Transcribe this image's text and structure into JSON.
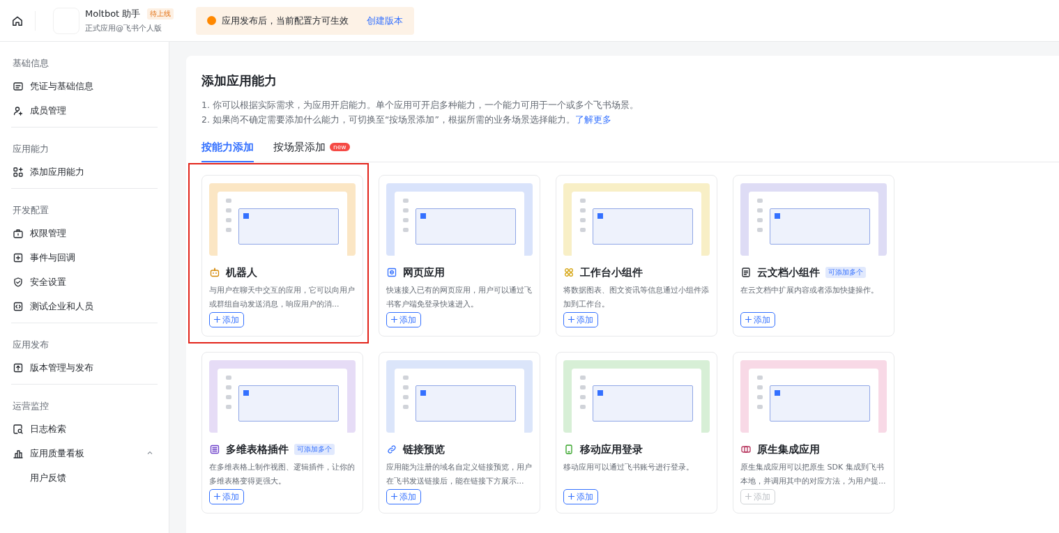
{
  "header": {
    "app_name": "Moltbot 助手",
    "status_badge": "待上线",
    "subtitle": "正式应用@飞书个人版"
  },
  "notice": {
    "text": "应用发布后，当前配置方可生效",
    "link": "创建版本"
  },
  "sidebar": {
    "sections": [
      {
        "label": "基础信息",
        "items": [
          {
            "label": "凭证与基础信息"
          },
          {
            "label": "成员管理"
          }
        ]
      },
      {
        "label": "应用能力",
        "items": [
          {
            "label": "添加应用能力"
          }
        ]
      },
      {
        "label": "开发配置",
        "items": [
          {
            "label": "权限管理"
          },
          {
            "label": "事件与回调"
          },
          {
            "label": "安全设置"
          },
          {
            "label": "测试企业和人员"
          }
        ]
      },
      {
        "label": "应用发布",
        "items": [
          {
            "label": "版本管理与发布"
          }
        ]
      },
      {
        "label": "运营监控",
        "items": [
          {
            "label": "日志检索"
          },
          {
            "label": "应用质量看板",
            "expanded": true,
            "children": [
              {
                "label": "用户反馈"
              }
            ]
          }
        ]
      }
    ]
  },
  "panel": {
    "title": "添加应用能力",
    "notes": [
      {
        "text": "1. 你可以根据实际需求，为应用开启能力。单个应用可开启多种能力，一个能力可用于一个或多个飞书场景。"
      },
      {
        "text": "2. 如果尚不确定需要添加什么能力，可切换至“按场景添加”，根据所需的业务场景选择能力。",
        "link": "了解更多"
      }
    ],
    "tabs": [
      {
        "label": "按能力添加",
        "selected": true
      },
      {
        "label": "按场景添加",
        "selected": false,
        "badge": "new"
      }
    ],
    "cards": [
      {
        "title": "机器人",
        "description": "与用户在聊天中交互的应用，它可以向用户或群组自动发送消息，响应用户的消...",
        "button": {
          "label": "添加",
          "disabled": false
        },
        "highlighted": true,
        "color": "#fbe6c4"
      },
      {
        "title": "网页应用",
        "description": "快速接入已有的网页应用，用户可以通过飞书客户端免登录快速进入。",
        "button": {
          "label": "添加",
          "disabled": false
        },
        "highlighted": false,
        "color": "#d9e3fb"
      },
      {
        "title": "工作台小组件",
        "description": "将数据图表、图文资讯等信息通过小组件添加到工作台。",
        "button": {
          "label": "添加",
          "disabled": false
        },
        "highlighted": false,
        "color": "#f8efc6"
      },
      {
        "title": "云文档小组件",
        "badge": "可添加多个",
        "description": "在云文档中扩展内容或者添加快捷操作。",
        "button": {
          "label": "添加",
          "disabled": false
        },
        "highlighted": false,
        "color": "#dedcf5"
      },
      {
        "title": "多维表格插件",
        "badge": "可添加多个",
        "description": "在多维表格上制作视图、逻辑插件，让你的多维表格变得更强大。",
        "button": {
          "label": "添加",
          "disabled": false
        },
        "highlighted": false,
        "color": "#e6dcf6"
      },
      {
        "title": "链接预览",
        "description": "应用能为注册的域名自定义链接预览，用户在飞书发送链接后，能在链接下方展示...",
        "button": {
          "label": "添加",
          "disabled": false
        },
        "highlighted": false,
        "color": "#dbe5fa"
      },
      {
        "title": "移动应用登录",
        "description": "移动应用可以通过飞书账号进行登录。",
        "button": {
          "label": "添加",
          "disabled": false
        },
        "highlighted": false,
        "color": "#d7efd6"
      },
      {
        "title": "原生集成应用",
        "description": "原生集成应用可以把原生 SDK 集成到飞书本地，并调用其中的对应方法，为用户提...",
        "button": {
          "label": "添加",
          "disabled": true
        },
        "highlighted": false,
        "color": "#f8d9e6"
      }
    ]
  }
}
